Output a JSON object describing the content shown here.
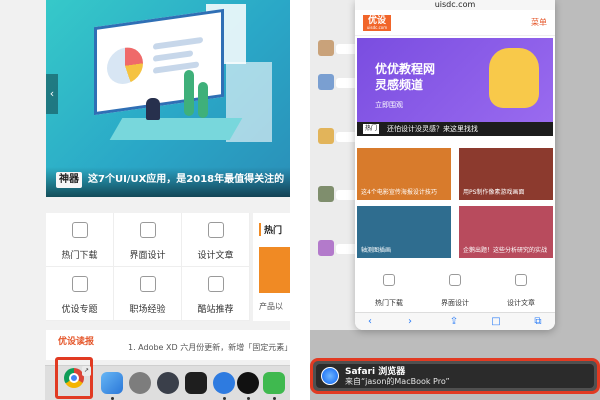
{
  "left": {
    "hero": {
      "tag": "神器",
      "title": "这7个UI/UX应用，是2018年最值得关注的"
    },
    "nav_grid": [
      {
        "label": "热门下载",
        "icon": "download-icon"
      },
      {
        "label": "界面设计",
        "icon": "phone-icon"
      },
      {
        "label": "设计文章",
        "icon": "article-icon"
      },
      {
        "label": "优设专题",
        "icon": "topic-icon"
      },
      {
        "label": "职场经验",
        "icon": "briefcase-icon"
      },
      {
        "label": "酷站推荐",
        "icon": "site-icon"
      }
    ],
    "hot": {
      "heading": "热门",
      "product": "产品以"
    },
    "news": {
      "title": "优设读报",
      "line": "1. Adobe XD 六月份更新，新增「固定元素」"
    },
    "dock": {
      "handoff_badge": "↗"
    }
  },
  "right": {
    "site_bar": "uisdc.com",
    "brand": {
      "logo": "优设",
      "sub": "uisdc.com",
      "menu": "菜单"
    },
    "banner": {
      "title_line1": "优优教程网",
      "title_line2": "灵感频道",
      "cta": "立即围观",
      "hot_tag": "热门",
      "strip_text": "还怕设计没灵感？来这里找找"
    },
    "tiles": [
      {
        "text": "这4个电影宣传海报设计技巧"
      },
      {
        "text": "用PS制作像素游戏画面"
      },
      {
        "text": "轴测图插画"
      },
      {
        "text": "企鹅出题！这些分析研究的实战"
      }
    ],
    "icons_row": [
      {
        "label": "热门下载",
        "icon": "download-icon"
      },
      {
        "label": "界面设计",
        "icon": "phone-icon"
      },
      {
        "label": "设计文章",
        "icon": "article-icon"
      }
    ],
    "toolbar": [
      "‹",
      "›",
      "⇪",
      "□",
      "⧉"
    ],
    "handoff": {
      "app": "Safari 浏览器",
      "from": "来自“jason的MacBook Pro”"
    }
  },
  "colors": {
    "highlight": "#e13a22",
    "accent": "#e5572b",
    "banner": "#7a4de0"
  }
}
